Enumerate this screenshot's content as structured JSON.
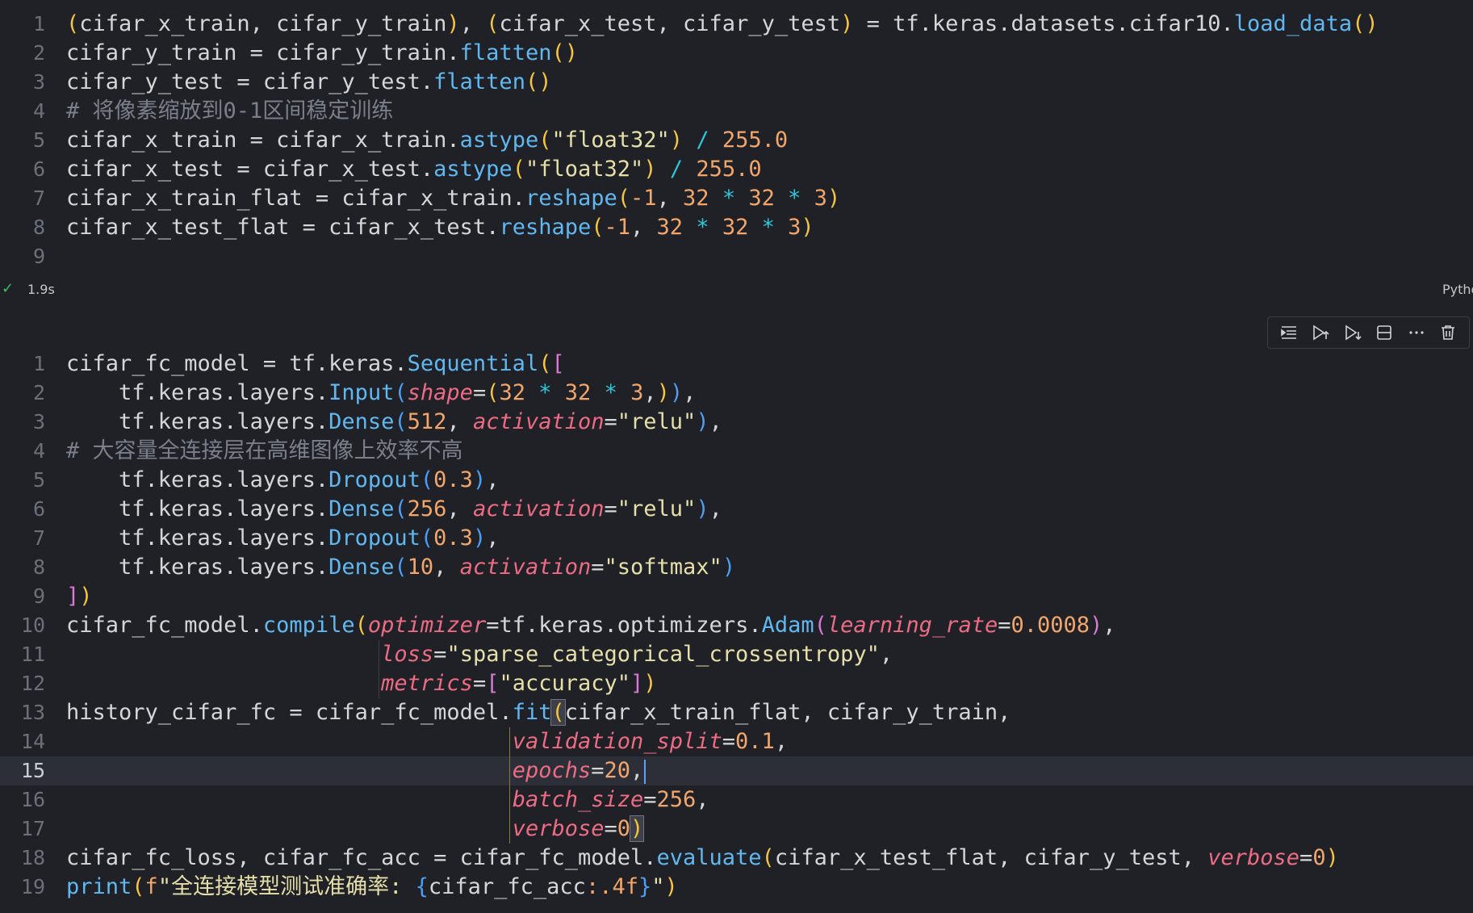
{
  "cell1": {
    "status": {
      "check": "✓",
      "time": "1.9s",
      "language": "Python"
    },
    "lines": [
      {
        "n": "1",
        "tokens": [
          {
            "t": "(",
            "c": "b1"
          },
          {
            "t": "cifar_x_train, cifar_y_train",
            "c": "id"
          },
          {
            "t": ")",
            "c": "b1"
          },
          {
            "t": ", ",
            "c": "id"
          },
          {
            "t": "(",
            "c": "b1"
          },
          {
            "t": "cifar_x_test, cifar_y_test",
            "c": "id"
          },
          {
            "t": ")",
            "c": "b1"
          },
          {
            "t": " = tf.keras.datasets.cifar10.",
            "c": "id"
          },
          {
            "t": "load_data",
            "c": "fn"
          },
          {
            "t": "()",
            "c": "b1"
          }
        ]
      },
      {
        "n": "2",
        "tokens": [
          {
            "t": "cifar_y_train = cifar_y_train.",
            "c": "id"
          },
          {
            "t": "flatten",
            "c": "fn"
          },
          {
            "t": "()",
            "c": "b1"
          }
        ]
      },
      {
        "n": "3",
        "tokens": [
          {
            "t": "cifar_y_test = cifar_y_test.",
            "c": "id"
          },
          {
            "t": "flatten",
            "c": "fn"
          },
          {
            "t": "()",
            "c": "b1"
          }
        ]
      },
      {
        "n": "4",
        "tokens": [
          {
            "t": "# 将像素缩放到0-1区间稳定训练",
            "c": "com"
          }
        ]
      },
      {
        "n": "5",
        "tokens": [
          {
            "t": "cifar_x_train = cifar_x_train.",
            "c": "id"
          },
          {
            "t": "astype",
            "c": "fn"
          },
          {
            "t": "(",
            "c": "b1"
          },
          {
            "t": "\"float32\"",
            "c": "str"
          },
          {
            "t": ")",
            "c": "b1"
          },
          {
            "t": " ",
            "c": "id"
          },
          {
            "t": "/",
            "c": "op"
          },
          {
            "t": " ",
            "c": "id"
          },
          {
            "t": "255.0",
            "c": "num"
          }
        ]
      },
      {
        "n": "6",
        "tokens": [
          {
            "t": "cifar_x_test = cifar_x_test.",
            "c": "id"
          },
          {
            "t": "astype",
            "c": "fn"
          },
          {
            "t": "(",
            "c": "b1"
          },
          {
            "t": "\"float32\"",
            "c": "str"
          },
          {
            "t": ")",
            "c": "b1"
          },
          {
            "t": " ",
            "c": "id"
          },
          {
            "t": "/",
            "c": "op"
          },
          {
            "t": " ",
            "c": "id"
          },
          {
            "t": "255.0",
            "c": "num"
          }
        ]
      },
      {
        "n": "7",
        "tokens": [
          {
            "t": "cifar_x_train_flat = cifar_x_train.",
            "c": "id"
          },
          {
            "t": "reshape",
            "c": "fn"
          },
          {
            "t": "(",
            "c": "b1"
          },
          {
            "t": "-1",
            "c": "num"
          },
          {
            "t": ", ",
            "c": "id"
          },
          {
            "t": "32",
            "c": "num"
          },
          {
            "t": " ",
            "c": "id"
          },
          {
            "t": "*",
            "c": "op"
          },
          {
            "t": " ",
            "c": "id"
          },
          {
            "t": "32",
            "c": "num"
          },
          {
            "t": " ",
            "c": "id"
          },
          {
            "t": "*",
            "c": "op"
          },
          {
            "t": " ",
            "c": "id"
          },
          {
            "t": "3",
            "c": "num"
          },
          {
            "t": ")",
            "c": "b1"
          }
        ]
      },
      {
        "n": "8",
        "tokens": [
          {
            "t": "cifar_x_test_flat = cifar_x_test.",
            "c": "id"
          },
          {
            "t": "reshape",
            "c": "fn"
          },
          {
            "t": "(",
            "c": "b1"
          },
          {
            "t": "-1",
            "c": "num"
          },
          {
            "t": ", ",
            "c": "id"
          },
          {
            "t": "32",
            "c": "num"
          },
          {
            "t": " ",
            "c": "id"
          },
          {
            "t": "*",
            "c": "op"
          },
          {
            "t": " ",
            "c": "id"
          },
          {
            "t": "32",
            "c": "num"
          },
          {
            "t": " ",
            "c": "id"
          },
          {
            "t": "*",
            "c": "op"
          },
          {
            "t": " ",
            "c": "id"
          },
          {
            "t": "3",
            "c": "num"
          },
          {
            "t": ")",
            "c": "b1"
          }
        ]
      },
      {
        "n": "9",
        "tokens": []
      }
    ]
  },
  "cell2": {
    "toolbar": [
      {
        "name": "run-by-line-icon",
        "label": "Run by line"
      },
      {
        "name": "run-above-icon",
        "label": "Execute above cells"
      },
      {
        "name": "run-below-icon",
        "label": "Execute cell and below"
      },
      {
        "name": "split-cell-icon",
        "label": "Split cell"
      },
      {
        "name": "more-actions-icon",
        "label": "More actions"
      },
      {
        "name": "delete-cell-icon",
        "label": "Delete cell"
      }
    ],
    "lines": [
      {
        "n": "1",
        "tokens": [
          {
            "t": "cifar_fc_model = tf.keras.",
            "c": "id"
          },
          {
            "t": "Sequential",
            "c": "fn"
          },
          {
            "t": "(",
            "c": "b1"
          },
          {
            "t": "[",
            "c": "b2"
          }
        ]
      },
      {
        "n": "2",
        "tokens": [
          {
            "t": "    tf.keras.layers.",
            "c": "id"
          },
          {
            "t": "Input",
            "c": "fn"
          },
          {
            "t": "(",
            "c": "b3"
          },
          {
            "t": "shape",
            "c": "kw"
          },
          {
            "t": "=",
            "c": "id"
          },
          {
            "t": "(",
            "c": "b1"
          },
          {
            "t": "32",
            "c": "num"
          },
          {
            "t": " ",
            "c": "id"
          },
          {
            "t": "*",
            "c": "op"
          },
          {
            "t": " ",
            "c": "id"
          },
          {
            "t": "32",
            "c": "num"
          },
          {
            "t": " ",
            "c": "id"
          },
          {
            "t": "*",
            "c": "op"
          },
          {
            "t": " ",
            "c": "id"
          },
          {
            "t": "3",
            "c": "num"
          },
          {
            "t": ",",
            "c": "id"
          },
          {
            "t": ")",
            "c": "b1"
          },
          {
            "t": ")",
            "c": "b3"
          },
          {
            "t": ",",
            "c": "id"
          }
        ]
      },
      {
        "n": "3",
        "tokens": [
          {
            "t": "    tf.keras.layers.",
            "c": "id"
          },
          {
            "t": "Dense",
            "c": "fn"
          },
          {
            "t": "(",
            "c": "b3"
          },
          {
            "t": "512",
            "c": "num"
          },
          {
            "t": ", ",
            "c": "id"
          },
          {
            "t": "activation",
            "c": "kw"
          },
          {
            "t": "=",
            "c": "id"
          },
          {
            "t": "\"relu\"",
            "c": "str"
          },
          {
            "t": ")",
            "c": "b3"
          },
          {
            "t": ",",
            "c": "id"
          }
        ]
      },
      {
        "n": "4",
        "tokens": [
          {
            "t": "# 大容量全连接层在高维图像上效率不高",
            "c": "com"
          }
        ]
      },
      {
        "n": "5",
        "tokens": [
          {
            "t": "    tf.keras.layers.",
            "c": "id"
          },
          {
            "t": "Dropout",
            "c": "fn"
          },
          {
            "t": "(",
            "c": "b3"
          },
          {
            "t": "0.3",
            "c": "num"
          },
          {
            "t": ")",
            "c": "b3"
          },
          {
            "t": ",",
            "c": "id"
          }
        ]
      },
      {
        "n": "6",
        "tokens": [
          {
            "t": "    tf.keras.layers.",
            "c": "id"
          },
          {
            "t": "Dense",
            "c": "fn"
          },
          {
            "t": "(",
            "c": "b3"
          },
          {
            "t": "256",
            "c": "num"
          },
          {
            "t": ", ",
            "c": "id"
          },
          {
            "t": "activation",
            "c": "kw"
          },
          {
            "t": "=",
            "c": "id"
          },
          {
            "t": "\"relu\"",
            "c": "str"
          },
          {
            "t": ")",
            "c": "b3"
          },
          {
            "t": ",",
            "c": "id"
          }
        ]
      },
      {
        "n": "7",
        "tokens": [
          {
            "t": "    tf.keras.layers.",
            "c": "id"
          },
          {
            "t": "Dropout",
            "c": "fn"
          },
          {
            "t": "(",
            "c": "b3"
          },
          {
            "t": "0.3",
            "c": "num"
          },
          {
            "t": ")",
            "c": "b3"
          },
          {
            "t": ",",
            "c": "id"
          }
        ]
      },
      {
        "n": "8",
        "tokens": [
          {
            "t": "    tf.keras.layers.",
            "c": "id"
          },
          {
            "t": "Dense",
            "c": "fn"
          },
          {
            "t": "(",
            "c": "b3"
          },
          {
            "t": "10",
            "c": "num"
          },
          {
            "t": ", ",
            "c": "id"
          },
          {
            "t": "activation",
            "c": "kw"
          },
          {
            "t": "=",
            "c": "id"
          },
          {
            "t": "\"softmax\"",
            "c": "str"
          },
          {
            "t": ")",
            "c": "b3"
          }
        ]
      },
      {
        "n": "9",
        "tokens": [
          {
            "t": "]",
            "c": "b2"
          },
          {
            "t": ")",
            "c": "b1"
          }
        ]
      },
      {
        "n": "10",
        "tokens": [
          {
            "t": "cifar_fc_model.",
            "c": "id"
          },
          {
            "t": "compile",
            "c": "fn"
          },
          {
            "t": "(",
            "c": "b1"
          },
          {
            "t": "optimizer",
            "c": "kw"
          },
          {
            "t": "=tf.keras.optimizers.",
            "c": "id"
          },
          {
            "t": "Adam",
            "c": "fn"
          },
          {
            "t": "(",
            "c": "b2"
          },
          {
            "t": "learning_rate",
            "c": "kw"
          },
          {
            "t": "=",
            "c": "id"
          },
          {
            "t": "0.0008",
            "c": "num"
          },
          {
            "t": ")",
            "c": "b2"
          },
          {
            "t": ",",
            "c": "id"
          }
        ]
      },
      {
        "n": "11",
        "guides": [
          1
        ],
        "tokens": [
          {
            "t": "                        ",
            "c": "id"
          },
          {
            "t": "loss",
            "c": "kw"
          },
          {
            "t": "=",
            "c": "id"
          },
          {
            "t": "\"sparse_categorical_crossentropy\"",
            "c": "str"
          },
          {
            "t": ",",
            "c": "id"
          }
        ]
      },
      {
        "n": "12",
        "guides": [
          1
        ],
        "tokens": [
          {
            "t": "                        ",
            "c": "id"
          },
          {
            "t": "metrics",
            "c": "kw"
          },
          {
            "t": "=",
            "c": "id"
          },
          {
            "t": "[",
            "c": "b2"
          },
          {
            "t": "\"accuracy\"",
            "c": "str"
          },
          {
            "t": "]",
            "c": "b2"
          },
          {
            "t": ")",
            "c": "b1"
          }
        ]
      },
      {
        "n": "13",
        "tokens": [
          {
            "t": "history_cifar_fc = cifar_fc_model.",
            "c": "id"
          },
          {
            "t": "fit",
            "c": "fn"
          },
          {
            "t": "(",
            "c": "b1m"
          },
          {
            "t": "cifar_x_train_flat, cifar_y_train,",
            "c": "id"
          }
        ]
      },
      {
        "n": "14",
        "guides": [
          2
        ],
        "tokens": [
          {
            "t": "                                  ",
            "c": "id"
          },
          {
            "t": "validation_split",
            "c": "kw"
          },
          {
            "t": "=",
            "c": "id"
          },
          {
            "t": "0.1",
            "c": "num"
          },
          {
            "t": ",",
            "c": "id"
          }
        ]
      },
      {
        "n": "15",
        "active": true,
        "guides": [
          2
        ],
        "tokens": [
          {
            "t": "                                  ",
            "c": "id"
          },
          {
            "t": "epochs",
            "c": "kw"
          },
          {
            "t": "=",
            "c": "id"
          },
          {
            "t": "20",
            "c": "num"
          },
          {
            "t": ",",
            "c": "id"
          },
          {
            "t": "",
            "c": "cursor"
          }
        ]
      },
      {
        "n": "16",
        "guides": [
          2
        ],
        "tokens": [
          {
            "t": "                                  ",
            "c": "id"
          },
          {
            "t": "batch_size",
            "c": "kw"
          },
          {
            "t": "=",
            "c": "id"
          },
          {
            "t": "256",
            "c": "num"
          },
          {
            "t": ",",
            "c": "id"
          }
        ]
      },
      {
        "n": "17",
        "guides": [
          2
        ],
        "tokens": [
          {
            "t": "                                  ",
            "c": "id"
          },
          {
            "t": "verbose",
            "c": "kw"
          },
          {
            "t": "=",
            "c": "id"
          },
          {
            "t": "0",
            "c": "num"
          },
          {
            "t": ")",
            "c": "b1m"
          }
        ]
      },
      {
        "n": "18",
        "tokens": [
          {
            "t": "cifar_fc_loss, cifar_fc_acc = cifar_fc_model.",
            "c": "id"
          },
          {
            "t": "evaluate",
            "c": "fn"
          },
          {
            "t": "(",
            "c": "b1"
          },
          {
            "t": "cifar_x_test_flat, cifar_y_test, ",
            "c": "id"
          },
          {
            "t": "verbose",
            "c": "kw"
          },
          {
            "t": "=",
            "c": "id"
          },
          {
            "t": "0",
            "c": "num"
          },
          {
            "t": ")",
            "c": "b1"
          }
        ]
      },
      {
        "n": "19",
        "tokens": [
          {
            "t": "print",
            "c": "fn"
          },
          {
            "t": "(",
            "c": "b1"
          },
          {
            "t": "f",
            "c": "pre"
          },
          {
            "t": "\"全连接模型测试准确率: ",
            "c": "str"
          },
          {
            "t": "{",
            "c": "b3"
          },
          {
            "t": "cifar_fc_acc",
            "c": "id"
          },
          {
            "t": ":.4f",
            "c": "num"
          },
          {
            "t": "}",
            "c": "b3"
          },
          {
            "t": "\"",
            "c": "str"
          },
          {
            "t": ")",
            "c": "b1"
          }
        ]
      }
    ]
  },
  "icons": {
    "check": "check-icon"
  }
}
